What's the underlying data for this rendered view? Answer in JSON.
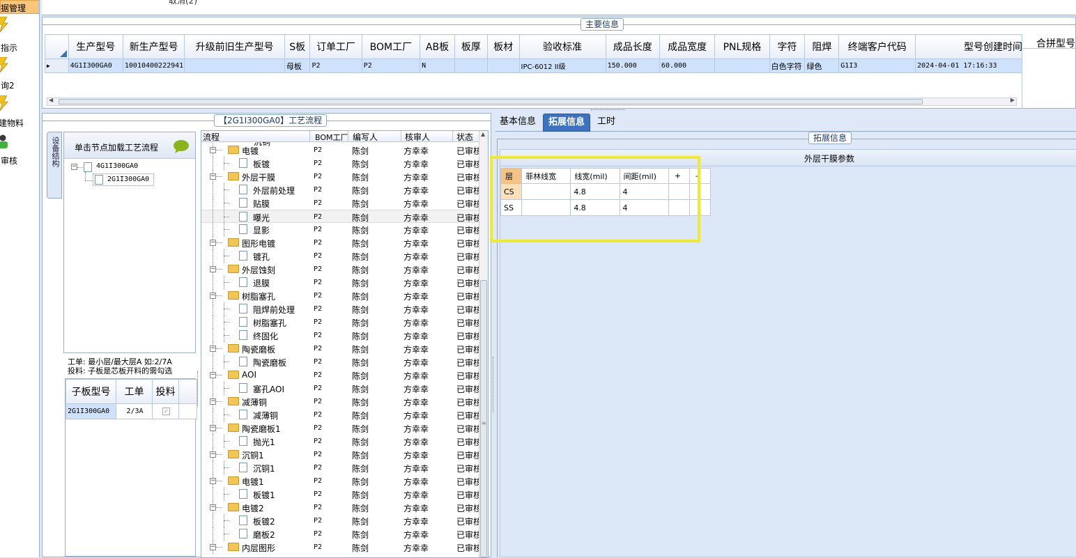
{
  "nav": {
    "active_label": "据管理",
    "items": [
      {
        "label": "指示",
        "icon": "lightning-icon"
      },
      {
        "label": "询2",
        "icon": "lightning-icon"
      },
      {
        "label": "建物料",
        "icon": "lightning-icon"
      },
      {
        "label": "审核",
        "icon": "user-green-icon"
      }
    ]
  },
  "top_strip": {
    "text": "取消(2)"
  },
  "main_info": {
    "title": "主要信息",
    "columns": [
      "生产型号",
      "新生产型号",
      "升级前旧生产型号",
      "S板",
      "订单工厂",
      "BOM工厂",
      "AB板",
      "板厚",
      "板材",
      "验收标准",
      "成品长度",
      "成品宽度",
      "PNL规格",
      "字符",
      "阻焊",
      "终端客户代码",
      "型号创建时间"
    ],
    "row": [
      "4G1I300GA0",
      "10010400222941",
      "",
      "母板",
      "P2",
      "P2",
      "N",
      "",
      "",
      "IPC-6012 II级",
      "150.000",
      "60.000",
      "",
      "白色字符",
      "绿色",
      "G1I3",
      "2024-04-01 17:16:33"
    ],
    "side_title": "合拼型号"
  },
  "process_panel": {
    "title": "【2G1I300GA0】工艺流程",
    "vtab_label": "设备结构",
    "tree_header": "单击节点加载工艺流程",
    "tree_nodes": [
      "4G1I300GA0",
      "2G1I300GA0"
    ],
    "hint_line1": "工单: 最小层/最大层A 如:2/7A",
    "hint_line2": "投料: 子板是芯板开料的需勾选",
    "sub_columns": [
      "子板型号",
      "工单",
      "投料"
    ],
    "sub_row": {
      "model": "2G1I300GA0",
      "order": "2/3A",
      "checked": true
    }
  },
  "flow": {
    "columns": [
      "流程",
      "BOM工厂",
      "编写人",
      "核审人",
      "状态"
    ],
    "partial_top": "沉铜",
    "rows": [
      {
        "name": "电镀",
        "level": 1,
        "folder": true
      },
      {
        "name": "板镀",
        "level": 2,
        "folder": false
      },
      {
        "name": "外层干膜",
        "level": 1,
        "folder": true
      },
      {
        "name": "外层前处理",
        "level": 2,
        "folder": false
      },
      {
        "name": "贴膜",
        "level": 2,
        "folder": false
      },
      {
        "name": "曝光",
        "level": 2,
        "folder": false,
        "selected": true
      },
      {
        "name": "显影",
        "level": 2,
        "folder": false
      },
      {
        "name": "图形电镀",
        "level": 1,
        "folder": true
      },
      {
        "name": "镀孔",
        "level": 2,
        "folder": false
      },
      {
        "name": "外层蚀刻",
        "level": 1,
        "folder": true
      },
      {
        "name": "退膜",
        "level": 2,
        "folder": false
      },
      {
        "name": "树脂塞孔",
        "level": 1,
        "folder": true
      },
      {
        "name": "阻焊前处理",
        "level": 2,
        "folder": false
      },
      {
        "name": "树脂塞孔",
        "level": 2,
        "folder": false
      },
      {
        "name": "终固化",
        "level": 2,
        "folder": false
      },
      {
        "name": "陶瓷磨板",
        "level": 1,
        "folder": true
      },
      {
        "name": "陶瓷磨板",
        "level": 2,
        "folder": false
      },
      {
        "name": "AOI",
        "level": 1,
        "folder": true
      },
      {
        "name": "塞孔AOI",
        "level": 2,
        "folder": false
      },
      {
        "name": "减薄铜",
        "level": 1,
        "folder": true
      },
      {
        "name": "减薄铜",
        "level": 2,
        "folder": false
      },
      {
        "name": "陶瓷磨板1",
        "level": 1,
        "folder": true
      },
      {
        "name": "抛光1",
        "level": 2,
        "folder": false
      },
      {
        "name": "沉铜1",
        "level": 1,
        "folder": true
      },
      {
        "name": "沉铜1",
        "level": 2,
        "folder": false
      },
      {
        "name": "电镀1",
        "level": 1,
        "folder": true
      },
      {
        "name": "板镀1",
        "level": 2,
        "folder": false
      },
      {
        "name": "电镀2",
        "level": 1,
        "folder": true
      },
      {
        "name": "板镀2",
        "level": 2,
        "folder": false
      },
      {
        "name": "磨板2",
        "level": 2,
        "folder": false
      },
      {
        "name": "内层图形",
        "level": 1,
        "folder": true
      }
    ],
    "factory": "P2",
    "writer": "陈剑",
    "reviewer": "方幸幸",
    "status": "已审核"
  },
  "right_tabs": [
    "基本信息",
    "拓展信息",
    "工时"
  ],
  "active_tab": "拓展信息",
  "ext": {
    "group_title": "拓展信息",
    "section_title": "外层干膜参数",
    "columns": [
      "层",
      "菲林线宽",
      "线宽(mil)",
      "间距(mil)",
      "+",
      "-"
    ],
    "rows": [
      {
        "layer": "CS",
        "film": "",
        "width": "4.8",
        "spacing": "4"
      },
      {
        "layer": "SS",
        "film": "",
        "width": "4.8",
        "spacing": "4"
      }
    ]
  },
  "colors": {
    "highlight_box": "#f0ea2a",
    "selected_row": "#cfe2fb",
    "active_tab": "#3d72c0",
    "panel_bg": "#dfe8f6"
  }
}
